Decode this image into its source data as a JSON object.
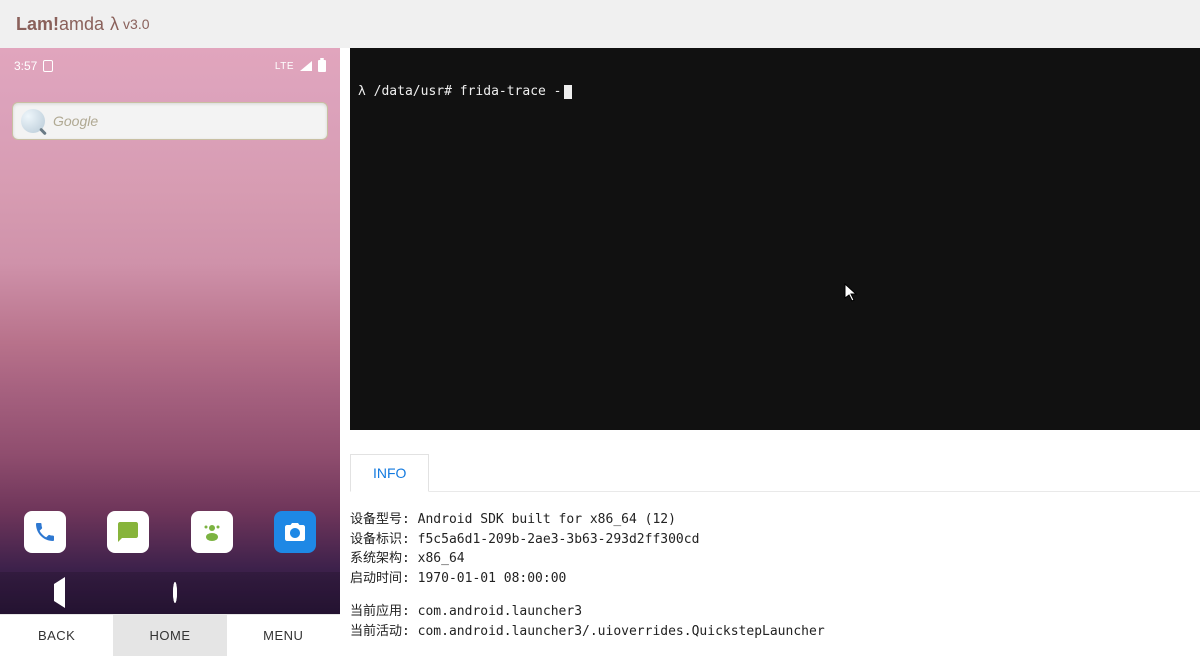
{
  "header": {
    "brand_prefix": "Lam",
    "brand_em": "!",
    "brand_suffix": "amda",
    "lambda": "λ",
    "version": "v3.0"
  },
  "phone": {
    "status": {
      "time": "3:57",
      "network": "LTE"
    },
    "search_placeholder": "Google",
    "dock": {
      "phone": "phone",
      "sms": "sms",
      "drawer": "apps",
      "camera": "camera"
    }
  },
  "controls": {
    "back": "BACK",
    "home": "HOME",
    "menu": "MENU",
    "selected": "home"
  },
  "terminal": {
    "prompt_symbol": "λ",
    "cwd": "/data/usr#",
    "command": "frida-trace -"
  },
  "tabs": {
    "info": "INFO"
  },
  "info": {
    "rows": [
      {
        "label": "设备型号:",
        "value": "Android SDK built for x86_64 (12)"
      },
      {
        "label": "设备标识:",
        "value": "f5c5a6d1-209b-2ae3-3b63-293d2ff300cd"
      },
      {
        "label": "系统架构:",
        "value": "x86_64"
      },
      {
        "label": "启动时间:",
        "value": "1970-01-01 08:00:00"
      }
    ],
    "rows2": [
      {
        "label": "当前应用:",
        "value": "com.android.launcher3"
      },
      {
        "label": "当前活动:",
        "value": "com.android.launcher3/.uioverrides.QuickstepLauncher"
      }
    ]
  }
}
